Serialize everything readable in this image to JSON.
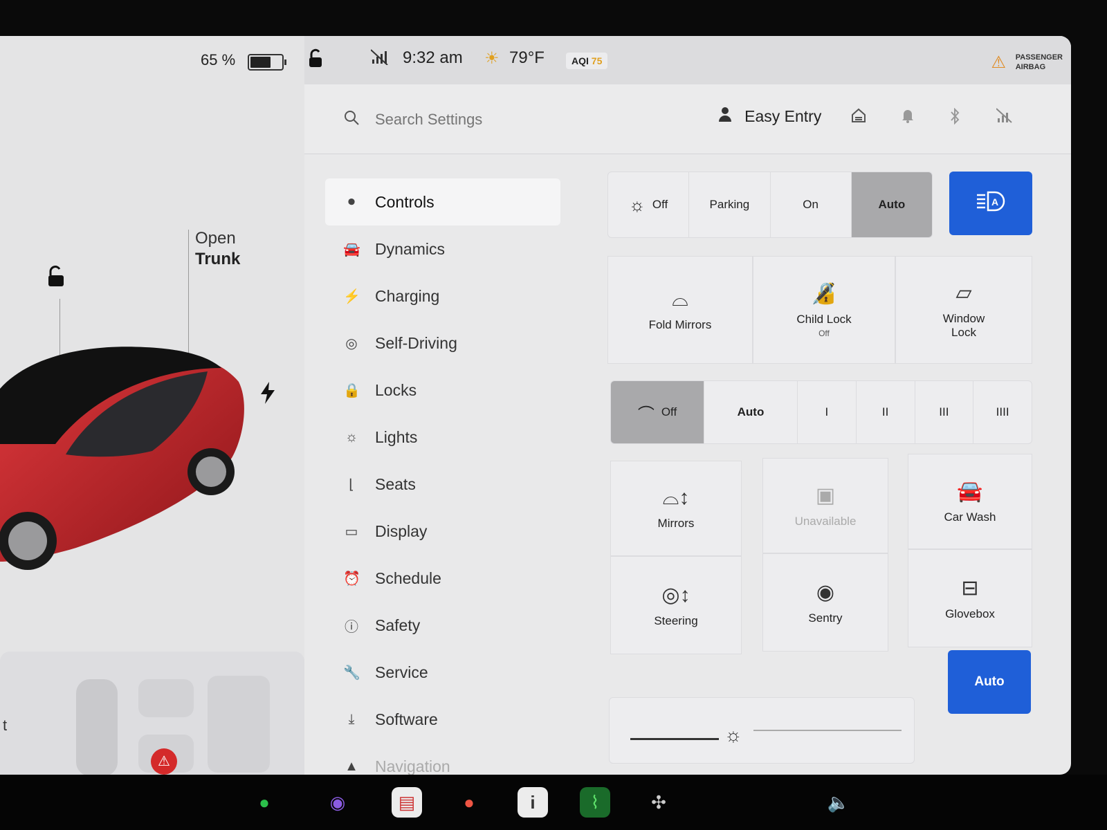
{
  "status": {
    "battery_percent": "65 %",
    "battery_level": 0.65,
    "time": "9:32 am",
    "temperature": "79°F",
    "aqi_label": "AQI",
    "aqi_value": "75",
    "airbag_line1": "PASSENGER",
    "airbag_line2": "AIRBAG"
  },
  "car": {
    "trunk_line1": "Open",
    "trunk_line2": "Trunk",
    "seat_panel_text": "t"
  },
  "search": {
    "placeholder": "Search Settings"
  },
  "profile": {
    "name": "Easy Entry"
  },
  "nav": {
    "items": [
      {
        "label": "Controls",
        "icon": "toggle-icon"
      },
      {
        "label": "Dynamics",
        "icon": "car-icon"
      },
      {
        "label": "Charging",
        "icon": "bolt-icon"
      },
      {
        "label": "Self-Driving",
        "icon": "steering-wheel-icon"
      },
      {
        "label": "Locks",
        "icon": "lock-icon"
      },
      {
        "label": "Lights",
        "icon": "light-icon"
      },
      {
        "label": "Seats",
        "icon": "seat-icon"
      },
      {
        "label": "Display",
        "icon": "display-icon"
      },
      {
        "label": "Schedule",
        "icon": "schedule-icon"
      },
      {
        "label": "Safety",
        "icon": "safety-icon"
      },
      {
        "label": "Service",
        "icon": "wrench-icon"
      },
      {
        "label": "Software",
        "icon": "download-icon"
      },
      {
        "label": "Navigation",
        "icon": "navigation-icon"
      }
    ]
  },
  "lights": {
    "options": [
      "Off",
      "Parking",
      "On",
      "Auto"
    ],
    "selected": "Auto"
  },
  "tiles_row1": {
    "fold_mirrors": "Fold Mirrors",
    "child_lock": "Child Lock",
    "child_lock_state": "Off",
    "window_lock_line1": "Window",
    "window_lock_line2": "Lock"
  },
  "wipers": {
    "options": [
      "Off",
      "Auto",
      "I",
      "II",
      "III",
      "IIII"
    ],
    "selected": "Off"
  },
  "tiles_row2": {
    "mirrors": "Mirrors",
    "unavailable": "Unavailable",
    "car_wash": "Car Wash",
    "steering": "Steering",
    "sentry": "Sentry",
    "glovebox": "Glovebox"
  },
  "brightness": {
    "auto_label": "Auto"
  },
  "colors": {
    "accent": "#1f5fd8",
    "car_body": "#c0262a",
    "warning": "#d42a2a"
  }
}
